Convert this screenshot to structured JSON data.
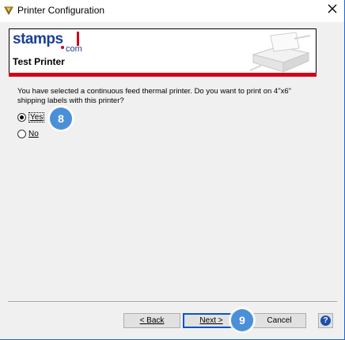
{
  "window": {
    "title": "Printer Configuration",
    "close_symbol": "✕"
  },
  "header": {
    "logo_text": "stamps",
    "logo_suffix": "com",
    "printer_name": "Test Printer"
  },
  "question": {
    "text": "You have selected a continuous feed thermal printer.  Do you want to print on 4\"x6\" shipping labels with this printer?"
  },
  "options": [
    {
      "label": "Yes",
      "checked": true
    },
    {
      "label": "No",
      "checked": false
    }
  ],
  "badges": {
    "step_yes": "8",
    "step_next": "9"
  },
  "footer": {
    "back_label": "< Back",
    "next_label": "Next >",
    "cancel_label": "Cancel",
    "help_symbol": "?"
  },
  "colors": {
    "brand_blue": "#1c3f94",
    "brand_red": "#d0021b",
    "badge_blue": "#4a90d9",
    "focus_blue": "#0b54c6"
  },
  "icons": {
    "title": "printer-config-icon",
    "close": "close-icon",
    "header_image": "printer-icon",
    "help": "help-icon"
  }
}
